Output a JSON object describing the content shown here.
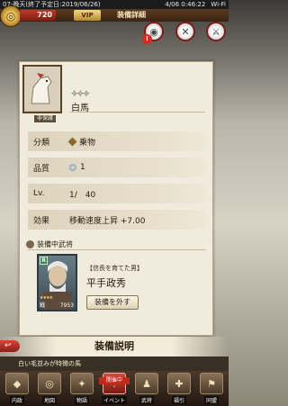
{
  "status_bar": {
    "server": "07-晩天(終了予定日:2019/06/26)",
    "datetime": "4/06 0:46:22",
    "wifi": "Wi-Fi"
  },
  "header": {
    "currency": "720",
    "vip": "VIP",
    "title": "装備詳細"
  },
  "header_buttons": [
    {
      "icon": "gift-icon",
      "glyph": "◉",
      "badge": "!"
    },
    {
      "icon": "swords-icon",
      "glyph": "✕"
    },
    {
      "icon": "sword-icon",
      "glyph": "⚔"
    }
  ],
  "item": {
    "stars": "✦✦✦",
    "name": "白馬",
    "protect_tag": "非保護"
  },
  "details": [
    {
      "label": "分類",
      "value": "乗物",
      "icon": "diamond-icon"
    },
    {
      "label": "品質",
      "value": "1",
      "icon": "quality-icon"
    },
    {
      "label": "Lv.",
      "value": "1/　40",
      "icon": ""
    },
    {
      "label": "効果",
      "value": "移動速度上昇 +7.00",
      "icon": ""
    }
  ],
  "equipped_section": {
    "heading": "装備中武将"
  },
  "officer": {
    "rarity": "R",
    "stars": "★★★★",
    "type": "戦",
    "power": "7953",
    "title": "【信長を育てた男】",
    "name": "平手政秀",
    "unequip_label": "装備を外す"
  },
  "description": {
    "heading": "装備説明",
    "back_label": "↩",
    "text": "白い毛並みが特徴の馬"
  },
  "bottom_nav": [
    {
      "label": "内政",
      "glyph": "◆",
      "icon": "castle-icon"
    },
    {
      "label": "地図",
      "glyph": "◎",
      "icon": "map-icon"
    },
    {
      "label": "物語",
      "glyph": "✦",
      "icon": "story-icon"
    },
    {
      "label": "イベント",
      "badge": "開催中",
      "glyph": "!",
      "icon": "event-icon"
    },
    {
      "label": "武将",
      "glyph": "♟",
      "icon": "officer-icon"
    },
    {
      "label": "福引",
      "glyph": "✚",
      "icon": "lottery-icon"
    },
    {
      "label": "同盟",
      "glyph": "⚑",
      "icon": "alliance-icon"
    }
  ]
}
